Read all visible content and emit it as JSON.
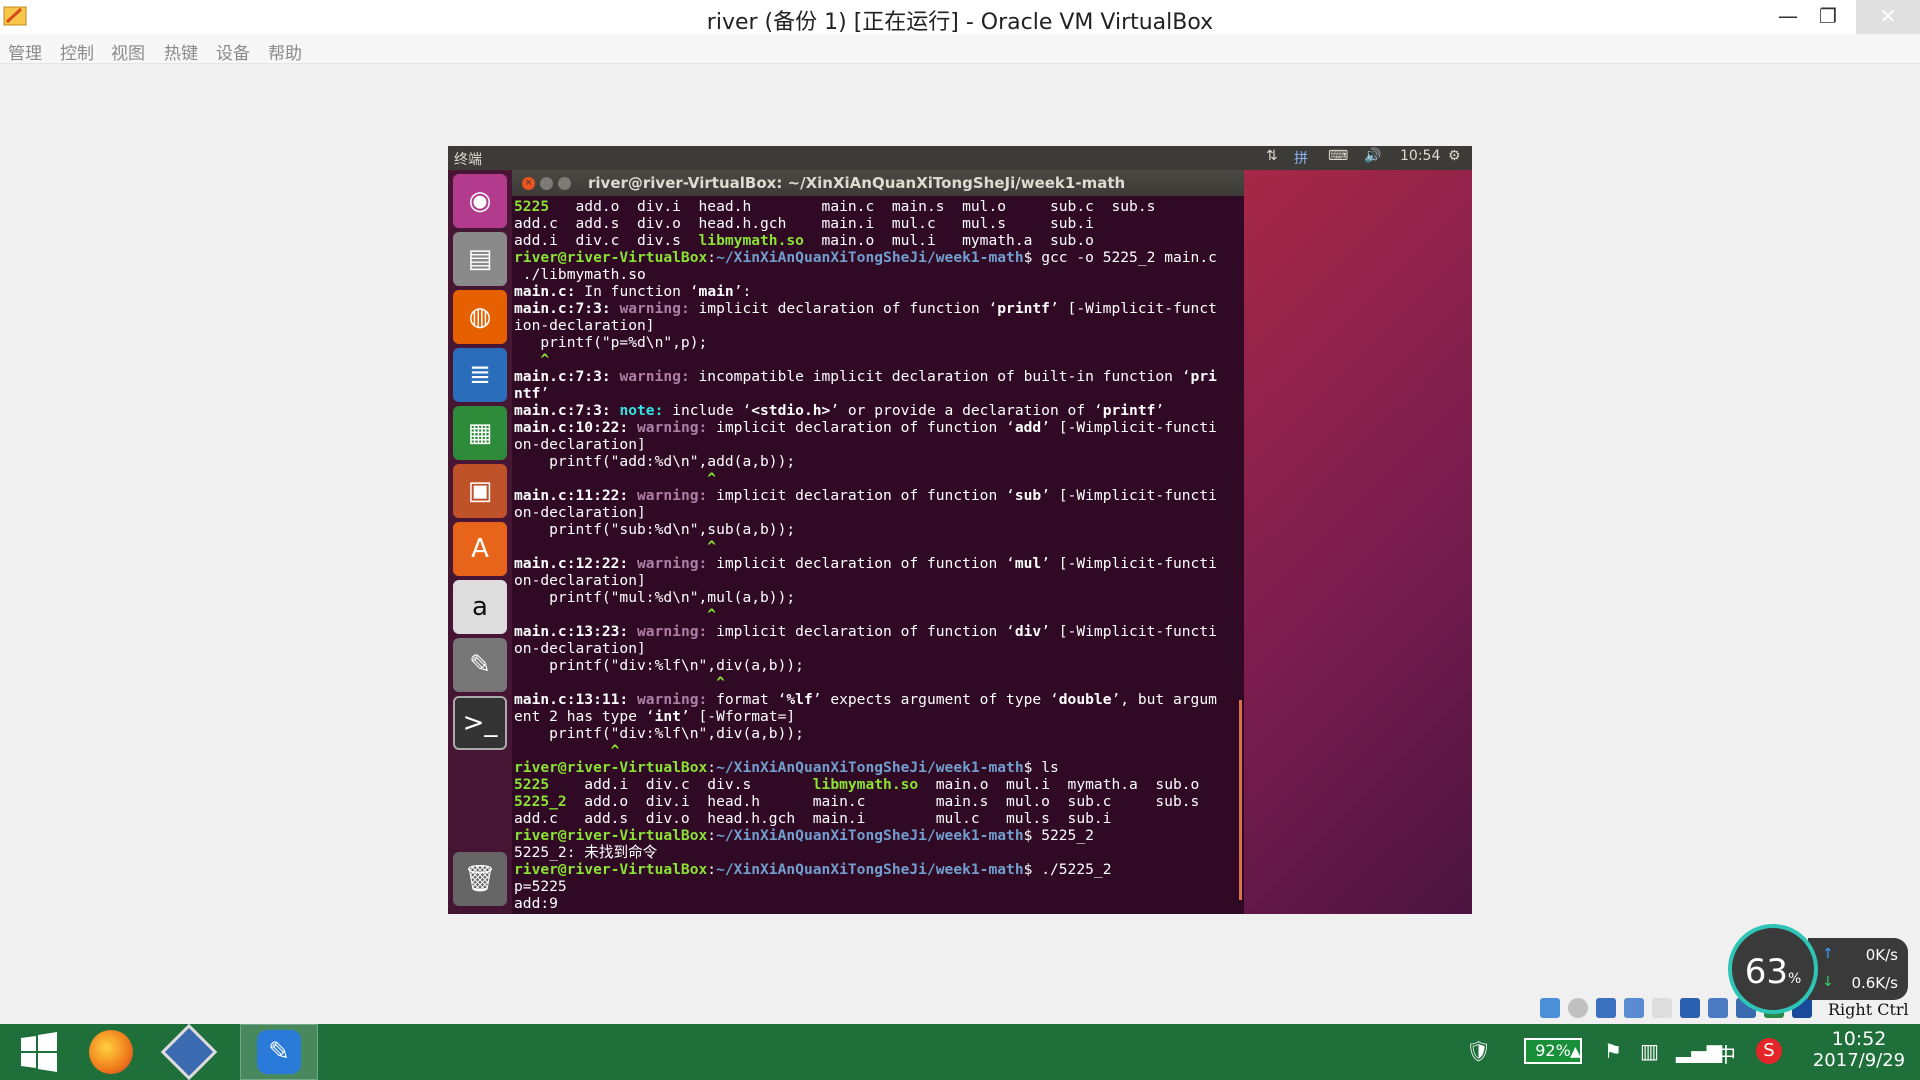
{
  "window": {
    "title": "river (备份 1) [正在运行] - Oracle VM VirtualBox",
    "min": "—",
    "max": "❐",
    "close": "✕"
  },
  "menu": [
    "管理",
    "控制",
    "视图",
    "热键",
    "设备",
    "帮助"
  ],
  "ubuntu_topbar": {
    "title": "终端",
    "clock": "10:54"
  },
  "launcher": [
    "dash-home",
    "files",
    "firefox",
    "libreoffice-writer",
    "libreoffice-calc",
    "libreoffice-impress",
    "software-center",
    "amazon",
    "system-settings",
    "terminal",
    "trash"
  ],
  "terminal": {
    "title": "river@river-VirtualBox: ~/XinXiAnQuanXiTongSheJi/week1-math",
    "lines": [
      [
        [
          "5225",
          "g"
        ],
        [
          "   add.o  div.i  head.h        main.c  main.s  mul.o     sub.c  sub.s",
          ""
        ]
      ],
      [
        [
          "add.c  add.s  div.o  head.h.gch    main.i  mul.c   mul.s     sub.i",
          ""
        ]
      ],
      [
        [
          "add.i  div.c  div.s  ",
          ""
        ],
        [
          "libmymath.so",
          "g"
        ],
        [
          "  main.o  mul.i   mymath.a  sub.o",
          ""
        ]
      ],
      [
        [
          "river@river-VirtualBox",
          "g"
        ],
        [
          ":",
          ""
        ],
        [
          "~/XinXiAnQuanXiTongSheJi/week1-math",
          "b"
        ],
        [
          "$ gcc -o 5225_2 main.c",
          ""
        ]
      ],
      [
        [
          " ./libmymath.so",
          ""
        ]
      ],
      [
        [
          "main.c:",
          "w"
        ],
        [
          " In function ‘",
          ""
        ],
        [
          "main",
          "w"
        ],
        [
          "’:",
          ""
        ]
      ],
      [
        [
          "main.c:7:3: ",
          "w"
        ],
        [
          "warning: ",
          "m"
        ],
        [
          "implicit declaration of function ‘",
          ""
        ],
        [
          "printf",
          "w"
        ],
        [
          "’ [-Wimplicit-funct",
          ""
        ]
      ],
      [
        [
          "ion-declaration]",
          ""
        ]
      ],
      [
        [
          "   printf(\"p=%d\\n\",p);",
          ""
        ]
      ],
      [
        [
          "   ^",
          "g"
        ]
      ],
      [
        [
          "main.c:7:3: ",
          "w"
        ],
        [
          "warning: ",
          "m"
        ],
        [
          "incompatible implicit declaration of built-in function ‘",
          ""
        ],
        [
          "pri",
          "w"
        ]
      ],
      [
        [
          "ntf",
          "w"
        ],
        [
          "’",
          ""
        ]
      ],
      [
        [
          "main.c:7:3: ",
          "w"
        ],
        [
          "note: ",
          "c"
        ],
        [
          "include ‘",
          ""
        ],
        [
          "<stdio.h>",
          "w"
        ],
        [
          "’ or provide a declaration of ‘",
          ""
        ],
        [
          "printf",
          "w"
        ],
        [
          "’",
          ""
        ]
      ],
      [
        [
          "main.c:10:22: ",
          "w"
        ],
        [
          "warning: ",
          "m"
        ],
        [
          "implicit declaration of function ‘",
          ""
        ],
        [
          "add",
          "w"
        ],
        [
          "’ [-Wimplicit-functi",
          ""
        ]
      ],
      [
        [
          "on-declaration]",
          ""
        ]
      ],
      [
        [
          "    printf(\"add:%d\\n\",add(a,b));",
          ""
        ]
      ],
      [
        [
          "                      ^",
          "g"
        ]
      ],
      [
        [
          "main.c:11:22: ",
          "w"
        ],
        [
          "warning: ",
          "m"
        ],
        [
          "implicit declaration of function ‘",
          ""
        ],
        [
          "sub",
          "w"
        ],
        [
          "’ [-Wimplicit-functi",
          ""
        ]
      ],
      [
        [
          "on-declaration]",
          ""
        ]
      ],
      [
        [
          "    printf(\"sub:%d\\n\",sub(a,b));",
          ""
        ]
      ],
      [
        [
          "                      ^",
          "g"
        ]
      ],
      [
        [
          "main.c:12:22: ",
          "w"
        ],
        [
          "warning: ",
          "m"
        ],
        [
          "implicit declaration of function ‘",
          ""
        ],
        [
          "mul",
          "w"
        ],
        [
          "’ [-Wimplicit-functi",
          ""
        ]
      ],
      [
        [
          "on-declaration]",
          ""
        ]
      ],
      [
        [
          "    printf(\"mul:%d\\n\",mul(a,b));",
          ""
        ]
      ],
      [
        [
          "                      ^",
          "g"
        ]
      ],
      [
        [
          "main.c:13:23: ",
          "w"
        ],
        [
          "warning: ",
          "m"
        ],
        [
          "implicit declaration of function ‘",
          ""
        ],
        [
          "div",
          "w"
        ],
        [
          "’ [-Wimplicit-functi",
          ""
        ]
      ],
      [
        [
          "on-declaration]",
          ""
        ]
      ],
      [
        [
          "    printf(\"div:%lf\\n\",div(a,b));",
          ""
        ]
      ],
      [
        [
          "                       ^",
          "g"
        ]
      ],
      [
        [
          "main.c:13:11: ",
          "w"
        ],
        [
          "warning: ",
          "m"
        ],
        [
          "format ‘",
          ""
        ],
        [
          "%lf",
          "w"
        ],
        [
          "’ expects argument of type ‘",
          ""
        ],
        [
          "double",
          "w"
        ],
        [
          "’, but argum",
          ""
        ]
      ],
      [
        [
          "ent 2 has type ‘",
          ""
        ],
        [
          "int",
          "w"
        ],
        [
          "’ [-Wformat=]",
          ""
        ]
      ],
      [
        [
          "    printf(\"div:%lf\\n\",div(a,b));",
          ""
        ]
      ],
      [
        [
          "           ^",
          "g"
        ]
      ],
      [
        [
          "river@river-VirtualBox",
          "g"
        ],
        [
          ":",
          ""
        ],
        [
          "~/XinXiAnQuanXiTongSheJi/week1-math",
          "b"
        ],
        [
          "$ ls",
          ""
        ]
      ],
      [
        [
          "5225",
          "g"
        ],
        [
          "    add.i  div.c  div.s       ",
          ""
        ],
        [
          "libmymath.so",
          "g"
        ],
        [
          "  main.o  mul.i  mymath.a  sub.o",
          ""
        ]
      ],
      [
        [
          "5225_2",
          "g"
        ],
        [
          "  add.o  div.i  head.h      main.c        main.s  mul.o  sub.c     sub.s",
          ""
        ]
      ],
      [
        [
          "add.c   add.s  div.o  head.h.gch  main.i        mul.c   mul.s  sub.i",
          ""
        ]
      ],
      [
        [
          "river@river-VirtualBox",
          "g"
        ],
        [
          ":",
          ""
        ],
        [
          "~/XinXiAnQuanXiTongSheJi/week1-math",
          "b"
        ],
        [
          "$ 5225_2",
          ""
        ]
      ],
      [
        [
          "5225_2: 未找到命令",
          ""
        ]
      ],
      [
        [
          "river@river-VirtualBox",
          "g"
        ],
        [
          ":",
          ""
        ],
        [
          "~/XinXiAnQuanXiTongSheJi/week1-math",
          "b"
        ],
        [
          "$ ./5225_2",
          ""
        ]
      ],
      [
        [
          "p=5225",
          ""
        ]
      ],
      [
        [
          "add:9",
          ""
        ]
      ]
    ]
  },
  "vm_status": {
    "host_key": "Right Ctrl"
  },
  "speed_widget": {
    "usage": "63",
    "usage_unit": "%",
    "upload": "0K/s",
    "download": "0.6K/s"
  },
  "taskbar": {
    "battery": "92%",
    "ime": "中",
    "time": "10:52",
    "date": "2017/9/29"
  },
  "colors": {
    "taskbar": "#1f6f3a",
    "terminal_bg": "#300a24",
    "prompt_user": "#8ae234",
    "prompt_path": "#729fcf",
    "warning": "#ad7fa8",
    "note": "#34e2e2"
  }
}
